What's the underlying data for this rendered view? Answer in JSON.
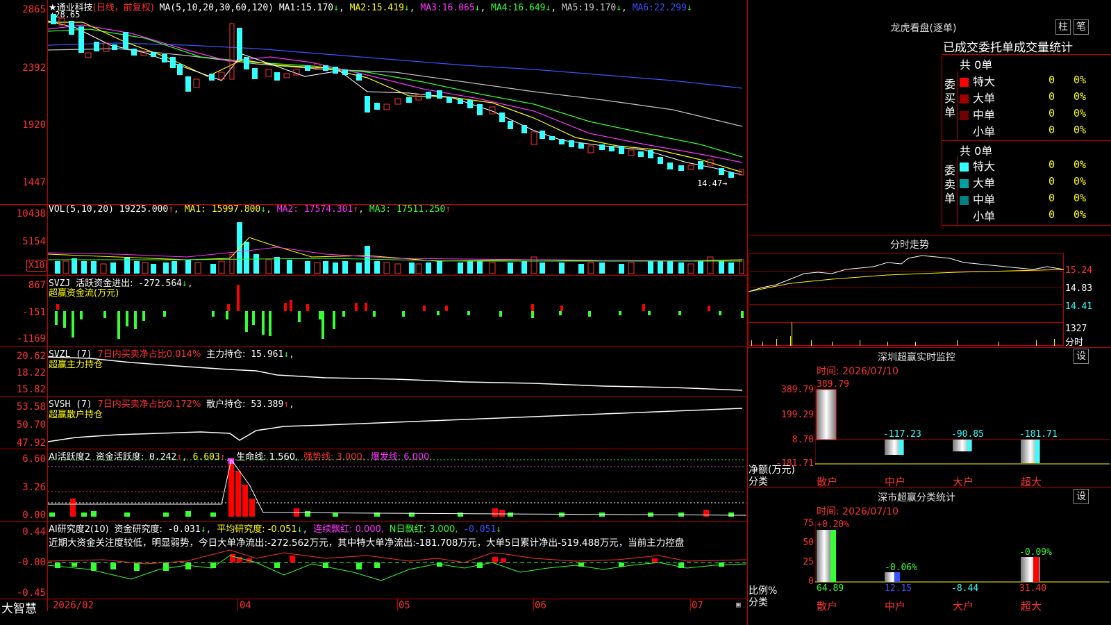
{
  "stock": {
    "name": "通业科技",
    "period": "(日线，前复权)",
    "ma_label": "MA(5,10,20,30,60,120)",
    "high_note": "28.65",
    "low_note": "14.47",
    "ma": [
      {
        "name": "MA1:",
        "value": "15.170",
        "arrow": "↓",
        "color": "#ffffff"
      },
      {
        "name": "MA2:",
        "value": "15.419",
        "arrow": "↓",
        "color": "#ffff00"
      },
      {
        "name": "MA3:",
        "value": "16.065",
        "arrow": "↓",
        "color": "#ff33ff"
      },
      {
        "name": "MA4:",
        "value": "16.649",
        "arrow": "↓",
        "color": "#33ff33"
      },
      {
        "name": "MA5:",
        "value": "19.170",
        "arrow": "↓",
        "color": "#c8c8c8"
      },
      {
        "name": "MA6:",
        "value": "22.299",
        "arrow": "↓",
        "color": "#3a52ff"
      }
    ],
    "price_axis": [
      "2865",
      "2392",
      "1920",
      "1447"
    ]
  },
  "vol": {
    "label": "VOL(5,10,20)",
    "value": "19225.000",
    "arrow": "↑",
    "ma1": "MA1: 15997.800",
    "ma1_arrow": "↓",
    "ma2": "MA2: 17574.301",
    "ma2_arrow": "↑",
    "ma3": "MA3: 17511.250",
    "ma3_arrow": "↑",
    "axis": [
      "10438",
      "5154"
    ],
    "unit": "X10"
  },
  "svzj": {
    "label": "SVZJ",
    "name": "活跃资金进出:",
    "value": "-272.564",
    "arrow": "↓",
    "sub": "超赢资金流(万元)",
    "axis": [
      "867",
      "-151",
      "-1169"
    ]
  },
  "svzl": {
    "label": "SVZL (7)",
    "desc": "7日内买卖净占比0.014%",
    "name": "主力持仓:",
    "value": "15.961",
    "arrow": "↓",
    "sub": "超赢主力持仓",
    "axis": [
      "20.62",
      "18.22",
      "15.82"
    ]
  },
  "svsh": {
    "label": "SVSH (7)",
    "desc": "7日内买卖净占比0.172%",
    "name": "散户持仓:",
    "value": "53.389",
    "arrow": "↑",
    "sub": "超赢散户持仓",
    "axis": [
      "53.58",
      "50.70",
      "47.92"
    ]
  },
  "ai1": {
    "label": "AI活跃度2",
    "name": "资金活跃度:",
    "value": "0.242",
    "arrow": "↑",
    "value2": "6.603",
    "arrow2": "↑",
    "life": "生命线: 1.560,",
    "strong": "强势线: 3.000,",
    "burst": "爆发线: 6.000,",
    "axis": [
      "6.60",
      "3.26",
      "0.00"
    ]
  },
  "ai2": {
    "label": "AI研究度2(10)",
    "name": "资金研究度:",
    "value": "-0.031",
    "arrow": "↓",
    "avg": "平均研究度: -0.051",
    "avg_arrow": "↓",
    "cont": "连续飘红: 0.000,",
    "nred": "N日飘红: 3.000,",
    "tail": "-0.051",
    "tail_arrow": "↓",
    "axis": [
      "0.44",
      "-0.00",
      "-0.45"
    ],
    "comment": "近期大资金关注度较低，明显弱势，今日大单净流出:-272.562万元，其中特大单净流出:-181.708万元，大单5日累计净出-519.488万元，当前主力控盘"
  },
  "time_axis": {
    "brand": "大智慧",
    "labels": [
      "2026/02",
      "04",
      "05",
      "06",
      "07"
    ]
  },
  "lhb": {
    "title": "龙虎看盘(逐单)",
    "btn_bar": "柱",
    "btn_pen": "笔",
    "header": "已成交委托单成交量统计",
    "buy": {
      "side": "委买单",
      "total": "共 0单",
      "rows": [
        {
          "name": "特大",
          "count": "0",
          "pct": "0%",
          "color": "#ff0000"
        },
        {
          "name": "大单",
          "count": "0",
          "pct": "0%",
          "color": "#a00000"
        },
        {
          "name": "中单",
          "count": "0",
          "pct": "0%",
          "color": "#700000"
        },
        {
          "name": "小单",
          "count": "0",
          "pct": "0%",
          "color": ""
        }
      ]
    },
    "sell": {
      "side": "委卖单",
      "total": "共 0单",
      "rows": [
        {
          "name": "特大",
          "count": "0",
          "pct": "0%",
          "color": "#33ffff"
        },
        {
          "name": "大单",
          "count": "0",
          "pct": "0%",
          "color": "#00a0a0"
        },
        {
          "name": "中单",
          "count": "0",
          "pct": "0%",
          "color": "#008080"
        },
        {
          "name": "小单",
          "count": "0",
          "pct": "0%",
          "color": ""
        }
      ]
    }
  },
  "intraday": {
    "title": "分时走势",
    "axis": [
      "15.24",
      "14.83",
      "14.41"
    ],
    "vol_axis": "1327",
    "vol_unit": "分时"
  },
  "monitor": {
    "title": "深圳超赢实时监控",
    "btn": "设",
    "time": "时间: 2026/07/10",
    "axis": [
      "389.79",
      "199.29",
      "8.70",
      "-181.71"
    ],
    "unit1": "净额(万元)",
    "unit2": "分类",
    "values": [
      "389.79",
      "-117.23",
      "-90.85",
      "-181.71"
    ],
    "cats": [
      "散户",
      "中户",
      "大户",
      "超大"
    ]
  },
  "classify": {
    "title": "深市超赢分类统计",
    "btn": "设",
    "time": "时间: 2026/07/10",
    "axis": [
      "75",
      "50",
      "25",
      "0"
    ],
    "unit1": "比例%",
    "unit2": "分类",
    "top": [
      "+0.20%",
      "-0.06%",
      "",
      "-0.09%"
    ],
    "values": [
      "64.89",
      "12.15",
      "-8.44",
      "31.40"
    ],
    "cats": [
      "散户",
      "中户",
      "大户",
      "超大"
    ]
  }
}
